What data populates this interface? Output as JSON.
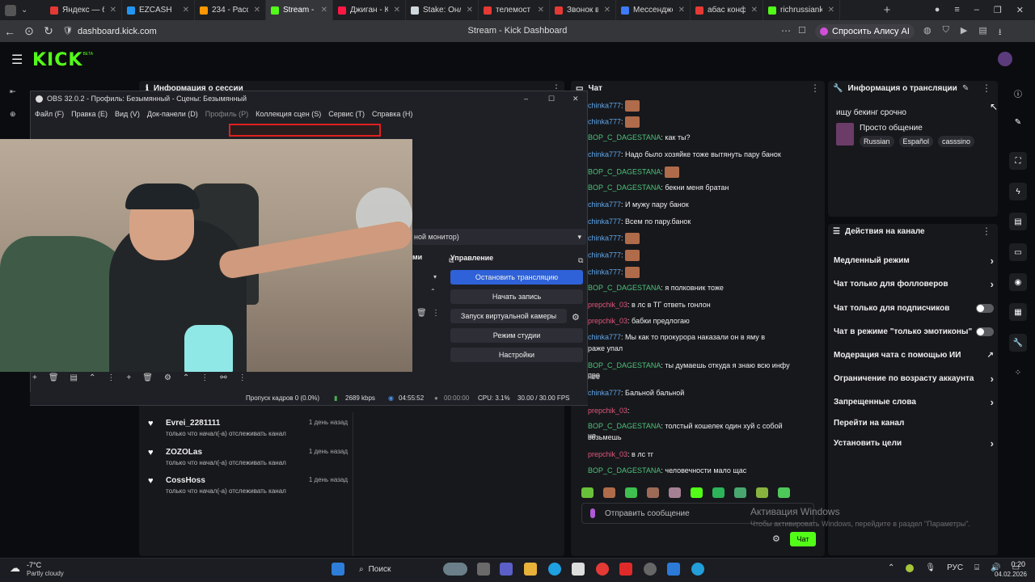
{
  "browser": {
    "tabs": [
      {
        "label": "Яндекс — быс",
        "color": "#e53935"
      },
      {
        "label": "EZCASH",
        "color": "#2196f3"
      },
      {
        "label": "234 - Рассылки",
        "color": "#ff9800"
      },
      {
        "label": "Stream - Kic",
        "color": "#53fc18",
        "active": true
      },
      {
        "label": "Джиган - Карм",
        "color": "#ff1744"
      },
      {
        "label": "Stake: Онлайн",
        "color": "#cfd8dc"
      },
      {
        "label": "телемост — Ян",
        "color": "#e53935"
      },
      {
        "label": "Звонок в",
        "color": "#e53935"
      },
      {
        "label": "Мессенджер",
        "color": "#3d7bf7"
      },
      {
        "label": "абас конферен",
        "color": "#e53935"
      },
      {
        "label": "richrussiankids",
        "color": "#53fc18"
      }
    ],
    "url": "dashboard.kick.com",
    "page_title": "Stream - Kick Dashboard",
    "alice_button": "Спросить Алису AI"
  },
  "kick": {
    "logo": "KICK",
    "logo_sup": "BETA"
  },
  "session_panel": {
    "title": "Информация о сессии"
  },
  "chat": {
    "title": "Чат",
    "messages": [
      {
        "user": "chinka777",
        "text": ":",
        "emote": true
      },
      {
        "user": "chinka777",
        "text": ":",
        "emote": true
      },
      {
        "user": "BOP_C_DAGESTANA",
        "text": ": как ты?"
      },
      {
        "user": "chinka777",
        "text": ": Надо было хозяйке тоже вытянуть пару банок"
      },
      {
        "user": "BOP_C_DAGESTANA",
        "text": ":",
        "emote": true
      },
      {
        "user": "BOP_C_DAGESTANA",
        "text": ": бекни меня братан"
      },
      {
        "user": "chinka777",
        "text": ": И мужу пару банок"
      },
      {
        "user": "chinka777",
        "text": ": Всем по пару.банок"
      },
      {
        "user": "chinka777",
        "text": ":",
        "emote": true
      },
      {
        "user": "chinka777",
        "text": ":",
        "emote": true
      },
      {
        "user": "chinka777",
        "text": ":",
        "emote": true
      },
      {
        "user": "BOP_C_DAGESTANA",
        "text": ": я полковник тоже"
      },
      {
        "user": "prepchik_03",
        "text": ": в лс в ТГ ответь гонлон"
      },
      {
        "user": "prepchik_03",
        "text": ": бабки предлогаю"
      },
      {
        "user": "chinka777",
        "text": ": Мы как то прокурора наказали он в яму в"
      },
      {
        "user": "",
        "text": "раже упал"
      },
      {
        "user": "BOP_C_DAGESTANA",
        "text": ": ты думаешь откуда я знаю всю инфу про"
      },
      {
        "user": "",
        "text": "нее"
      },
      {
        "user": "chinka777",
        "text": ": Бальной бальной"
      },
      {
        "user": "prepchik_03",
        "text": ":"
      },
      {
        "user": "BOP_C_DAGESTANA",
        "text": ": толстый кошелек один хуй с собой не"
      },
      {
        "user": "",
        "text": "возьмешь"
      },
      {
        "user": "prepchik_03",
        "text": ": в лс тг"
      },
      {
        "user": "BOP_C_DAGESTANA",
        "text": ": человечности мало щас"
      }
    ],
    "input_placeholder": "Отправить сообщение",
    "send_label": "Чат"
  },
  "stream_info": {
    "title": "Информация о трансляции",
    "stream_title": "ищу бекинг срочно",
    "category": "Просто общение",
    "tags": [
      "Russian",
      "Español",
      "casssino"
    ]
  },
  "channel_actions": {
    "title": "Действия на канале",
    "items": [
      {
        "label": "Медленный режим",
        "control": "chevron"
      },
      {
        "label": "Чат только для фолловеров",
        "control": "chevron"
      },
      {
        "label": "Чат только для подписчиков",
        "control": "toggle"
      },
      {
        "label": "Чат в режиме \"только эмотиконы\"",
        "control": "toggle"
      },
      {
        "label": "Модерация чата с помощью ИИ",
        "control": "external"
      },
      {
        "label": "Ограничение по возрасту аккаунта",
        "control": "chevron"
      },
      {
        "label": "Запрещенные слова",
        "control": "chevron"
      },
      {
        "label": "Перейти на канал",
        "control": "none"
      },
      {
        "label": "Установить цели",
        "control": "chevron"
      }
    ]
  },
  "followers": [
    {
      "name": "Evrei_2281111",
      "sub": "только что начал(-а) отслеживать канал",
      "time": "1 день назад"
    },
    {
      "name": "ZOZOLas",
      "sub": "только что начал(-а) отслеживать канал",
      "time": "1 день назад"
    },
    {
      "name": "CossHoss",
      "sub": "только что начал(-а) отслеживать канал",
      "time": "1 день назад"
    }
  ],
  "obs": {
    "title": "OBS 32.0.2 - Профиль: Безымянный - Сцены: Безымянный",
    "menu": [
      "Файл (F)",
      "Правка (E)",
      "Вид (V)",
      "Док-панели (D)",
      "Профиль (P)",
      "Коллекция сцен (S)",
      "Сервис (T)",
      "Справка (H)"
    ],
    "monitor_label": "ной монитор)",
    "sources_header": "ми",
    "controls_header": "Управление",
    "buttons": [
      "Остановить трансляцию",
      "Начать запись",
      "Запуск виртуальной камеры",
      "Режим студии",
      "Настройки"
    ],
    "status": {
      "dropped": "Пропуск кадров 0 (0.0%)",
      "bitrate": "2689 kbps",
      "live_time": "04:55:52",
      "rec_time": "00:00:00",
      "cpu": "CPU: 3.1%",
      "fps": "30.00 / 30.00 FPS"
    }
  },
  "windows": {
    "activation_title": "Активация Windows",
    "activation_sub": "Чтобы активировать Windows, перейдите в раздел \"Параметры\".",
    "weather_temp": "-7°C",
    "weather_desc": "Partly cloudy",
    "search": "Поиск",
    "lang": "РУС",
    "time": "0:20",
    "date": "04.02.2026"
  }
}
